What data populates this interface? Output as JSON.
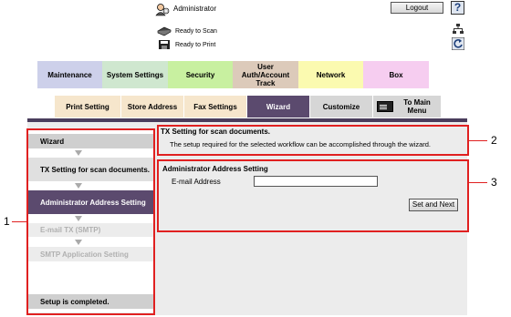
{
  "header": {
    "user_name": "Administrator",
    "logout_label": "Logout",
    "help_label": "?",
    "scan_status": "Ready to Scan",
    "print_status": "Ready to Print"
  },
  "main_tabs": [
    {
      "label": "Maintenance",
      "color": "#cdd0ea"
    },
    {
      "label": "System Settings",
      "color": "#cfe7cf"
    },
    {
      "label": "Security",
      "color": "#c8f0a0"
    },
    {
      "label": "User Auth/Account Track",
      "color": "#dccaba"
    },
    {
      "label": "Network",
      "color": "#fbfab0"
    },
    {
      "label": "Box",
      "color": "#f6cdf0"
    }
  ],
  "sub_tabs": [
    {
      "label": "Print Setting"
    },
    {
      "label": "Store Address"
    },
    {
      "label": "Fax Settings"
    },
    {
      "label": "Wizard"
    },
    {
      "label": "Customize"
    },
    {
      "label": "To Main Menu"
    }
  ],
  "wizard": {
    "head": "Wizard",
    "steps": [
      "TX Setting for scan documents.",
      "Administrator Address Setting",
      "E-mail TX (SMTP)",
      "SMTP Application Setting"
    ],
    "footer": "Setup is completed."
  },
  "info": {
    "title": "TX Setting for scan documents.",
    "description": "The setup required for the selected workflow can be accomplished through the wizard."
  },
  "settings": {
    "title": "Administrator Address Setting",
    "email_label": "E-mail Address",
    "email_value": "",
    "submit_label": "Set and Next"
  },
  "callouts": [
    "1",
    "2",
    "3"
  ],
  "colors": {
    "accent": "#5b4a6e",
    "callout": "#e02020"
  }
}
